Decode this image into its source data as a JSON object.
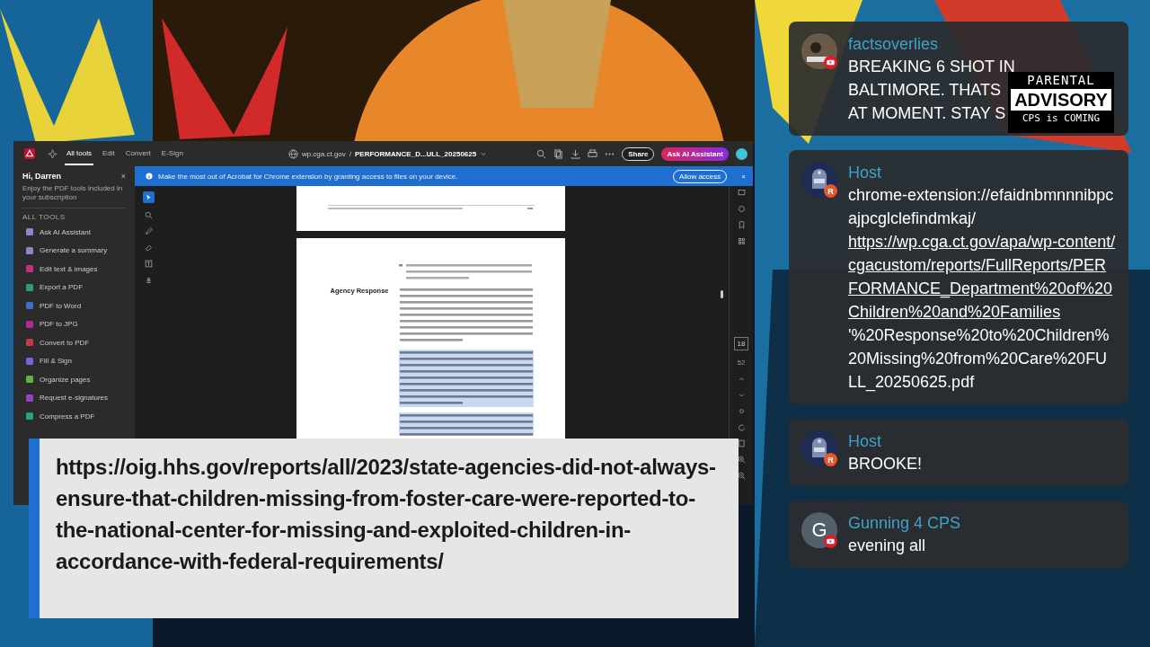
{
  "acrobat": {
    "toolbar": {
      "tabs": [
        {
          "label": "All tools",
          "selected": true
        },
        {
          "label": "Edit",
          "selected": false
        },
        {
          "label": "Convert",
          "selected": false
        },
        {
          "label": "E-Sign",
          "selected": false
        }
      ],
      "domain": "wp.cga.ct.gov",
      "separator": "/",
      "filename": "PERFORMANCE_D...ULL_20250625",
      "share": "Share",
      "ai_button": "Ask AI Assistant"
    },
    "banner": {
      "message": "Make the most out of Acrobat for Chrome extension by granting access to files on your device.",
      "button": "Allow access",
      "close": "×"
    },
    "sidebar": {
      "greeting": "Hi, Darren",
      "close": "×",
      "subtitle": "Enjoy the PDF tools included in your subscription",
      "section": "ALL TOOLS",
      "tools": [
        {
          "label": "Ask AI Assistant",
          "color": "#8c86c8"
        },
        {
          "label": "Generate a summary",
          "color": "#8c86c8"
        },
        {
          "label": "Edit text & images",
          "color": "#c2307f"
        },
        {
          "label": "Export a PDF",
          "color": "#2e9e78"
        },
        {
          "label": "PDF to Word",
          "color": "#3f6fc9"
        },
        {
          "label": "PDF to JPG",
          "color": "#b0289a"
        },
        {
          "label": "Convert to PDF",
          "color": "#c23a4c"
        },
        {
          "label": "Fill & Sign",
          "color": "#7d5fd6"
        },
        {
          "label": "Organize pages",
          "color": "#5fb33a"
        },
        {
          "label": "Request e-signatures",
          "color": "#9a3fc7"
        },
        {
          "label": "Compress a PDF",
          "color": "#2aa36a"
        }
      ]
    },
    "page_nav": {
      "current": "18",
      "total": "52"
    },
    "document": {
      "section_label": "Agency Response",
      "paragraphs": [
        {
          "highlighted": false
        },
        {
          "highlighted": true
        },
        {
          "highlighted": true
        }
      ]
    }
  },
  "caption": {
    "url": "https://oig.hhs.gov/reports/all/2023/state-agencies-did-not-always-ensure-that-children-missing-from-foster-care-were-reported-to-the-national-center-for-missing-and-exploited-children-in-accordance-with-federal-requirements/"
  },
  "chat": [
    {
      "author": "factsoverlies",
      "avatar": {
        "kind": "picture"
      },
      "badge": {
        "kind": "youtube"
      },
      "lines": [
        "BREAKING 6 SHOT IN",
        "BALTIMORE. THATS",
        "AT MOMENT. STAY S"
      ]
    },
    {
      "author": "Host",
      "avatar": {
        "kind": "robot"
      },
      "badge": {
        "kind": "letter",
        "text": "R"
      },
      "segments": [
        {
          "kind": "text",
          "text": "chrome-extension://efaidnbmnnnibpcajpcglclefindmkaj/"
        },
        {
          "kind": "link",
          "text": "https://wp.cga.ct.gov/apa/wp-content/cgacustom/reports/FullReports/PERFORMANCE_Department%20of%20Children%20and%20Families"
        },
        {
          "kind": "text",
          "text": "'%20Response%20to%20Children%20Missing%20from%20Care%20FULL_20250625.pdf"
        }
      ]
    },
    {
      "author": "Host",
      "avatar": {
        "kind": "robot"
      },
      "badge": {
        "kind": "letter",
        "text": "R"
      },
      "lines": [
        "BROOKE!"
      ]
    },
    {
      "author": "Gunning 4 CPS",
      "avatar": {
        "kind": "letter",
        "text": "G"
      },
      "badge": {
        "kind": "youtube"
      },
      "lines": [
        "evening all"
      ]
    }
  ],
  "advisory": {
    "lines": [
      "PARENTAL",
      "ADVISORY",
      "CPS is COMING"
    ]
  }
}
